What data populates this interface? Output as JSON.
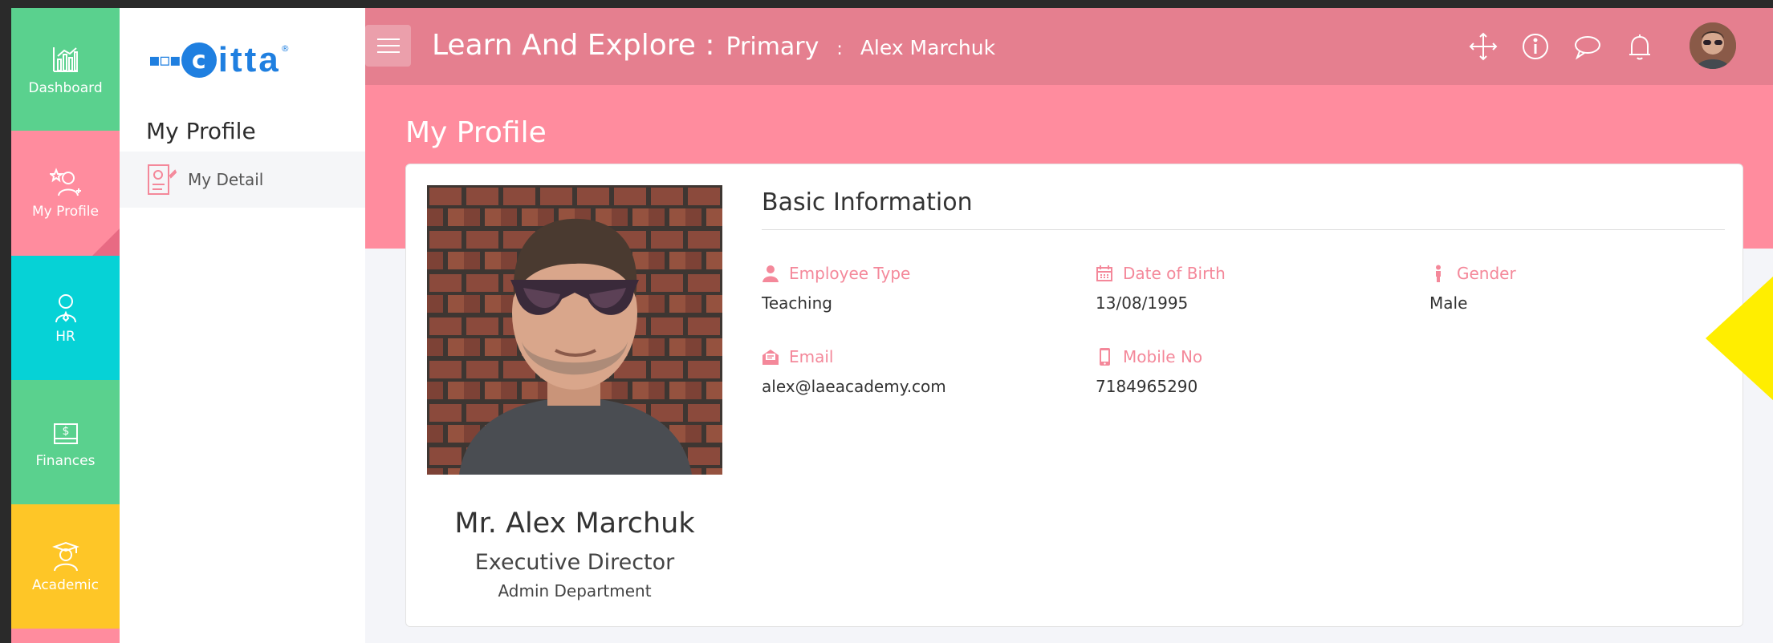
{
  "rail": [
    {
      "label": "Dashboard",
      "icon": "dashboard-chart-icon"
    },
    {
      "label": "My Profile",
      "icon": "profile-star-icon"
    },
    {
      "label": "HR",
      "icon": "hr-person-icon"
    },
    {
      "label": "Finances",
      "icon": "finance-dollar-icon"
    },
    {
      "label": "Academic",
      "icon": "academic-graduate-icon"
    }
  ],
  "logo": {
    "mark": "c",
    "text": "itta",
    "reg": "®"
  },
  "subnav": {
    "title": "My Profile",
    "items": [
      {
        "label": "My Detail",
        "icon": "detail-document-icon"
      }
    ]
  },
  "header": {
    "app_title": "Learn And Explore :",
    "section": "Primary",
    "separator": ":",
    "user": "Alex Marchuk",
    "icons": [
      "move-icon",
      "info-icon",
      "chat-icon",
      "bell-icon",
      "user-avatar"
    ]
  },
  "page": {
    "title": "My Profile"
  },
  "profile": {
    "name": "Mr. Alex Marchuk",
    "role": "Executive Director",
    "department": "Admin Department"
  },
  "basic_info": {
    "title": "Basic Information",
    "fields": [
      {
        "label": "Employee Type",
        "value": "Teaching",
        "icon": "user-icon"
      },
      {
        "label": "Date of Birth",
        "value": "13/08/1995",
        "icon": "calendar-icon"
      },
      {
        "label": "Gender",
        "value": "Male",
        "icon": "gender-person-icon"
      },
      {
        "label": "Email",
        "value": "alex@laeacademy.com",
        "icon": "email-icon"
      },
      {
        "label": "Mobile No",
        "value": "7184965290",
        "icon": "mobile-icon"
      }
    ]
  },
  "colors": {
    "header": "#e57f8f",
    "band": "#ff8c9e",
    "rail_green": "#5ad18e",
    "rail_pink": "#ff8c9e",
    "rail_cyan": "#06d2d6",
    "rail_yellow": "#fec627",
    "label_pink": "#f4889a",
    "pointer_yellow": "#ffee00"
  }
}
